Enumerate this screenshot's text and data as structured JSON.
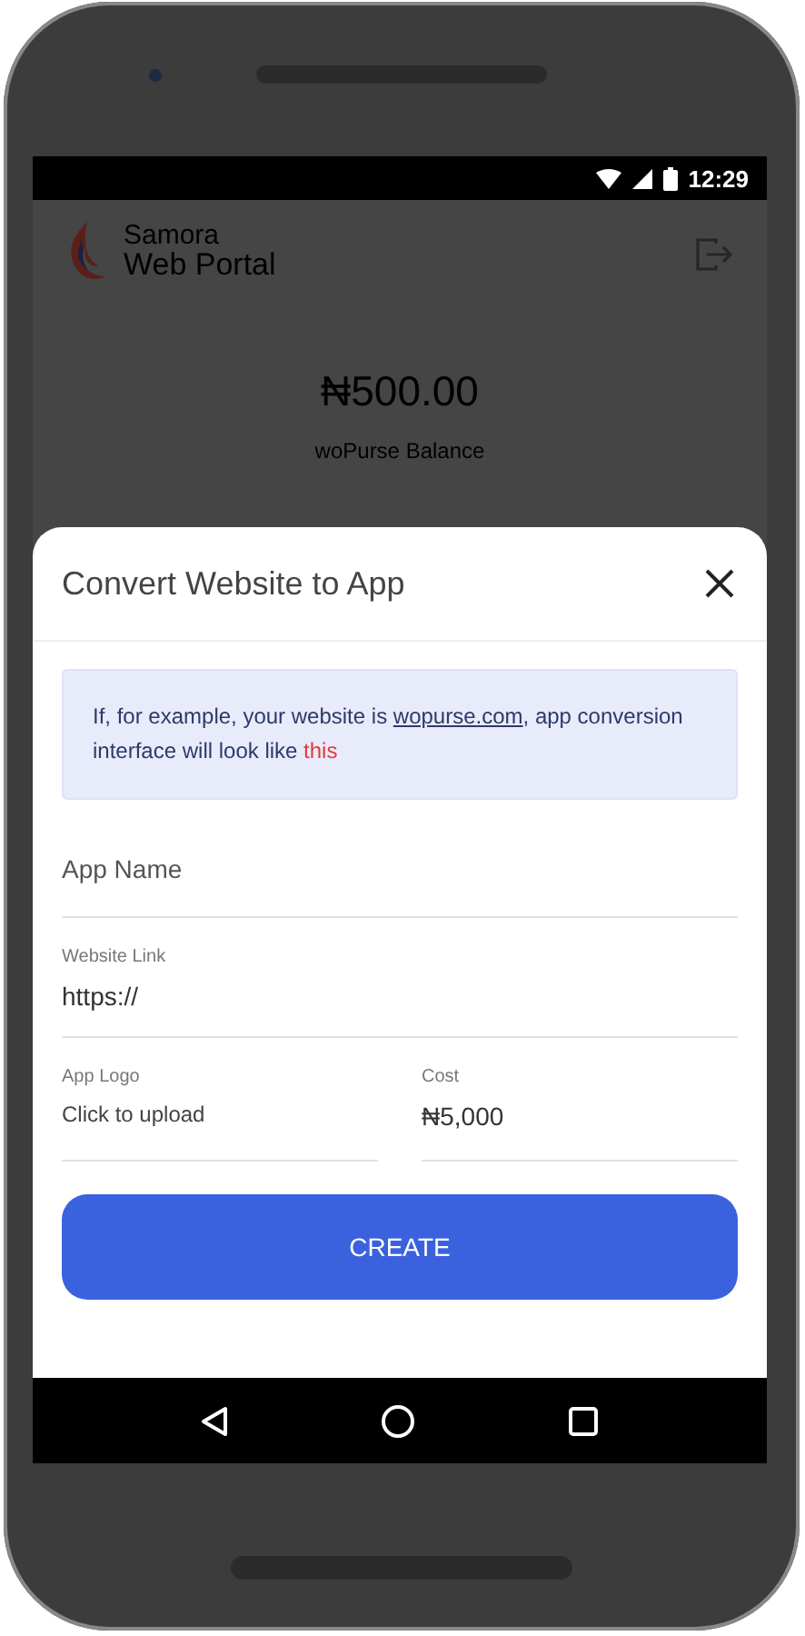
{
  "status_bar": {
    "time": "12:29"
  },
  "header": {
    "brand_top": "Samora",
    "brand_bottom": "Web Portal"
  },
  "balance": {
    "amount": "₦500.00",
    "label": "woPurse Balance"
  },
  "dialog": {
    "title": "Convert Website to App",
    "notice": {
      "before": "If, for example, your website is ",
      "link": "wopurse.com",
      "middle": ", app conversion interface will look like ",
      "action": "this"
    },
    "fields": [
      {
        "kind": "text",
        "placeholder": "App Name"
      },
      {
        "kind": "text",
        "label": "Website Link",
        "value": "https://"
      }
    ],
    "row": [
      {
        "kind": "upload",
        "label": "App Logo",
        "value": "Click to upload"
      },
      {
        "kind": "text",
        "label": "Cost",
        "value": "₦5,000"
      }
    ],
    "button": "CREATE"
  }
}
